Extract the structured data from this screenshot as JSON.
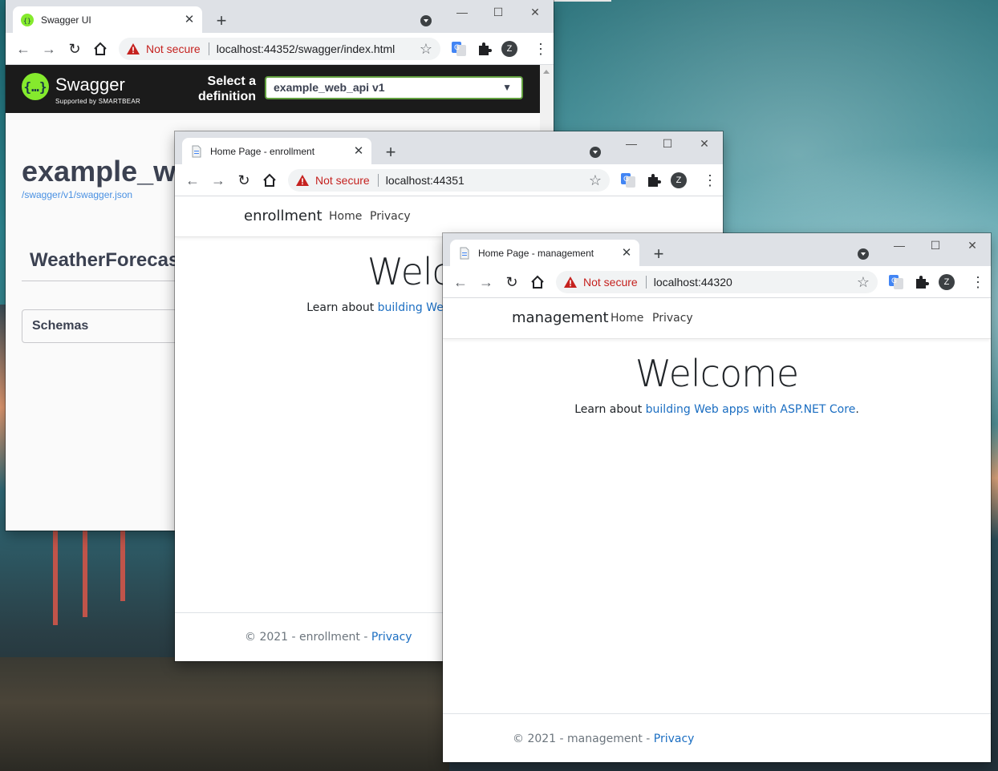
{
  "swagger_window": {
    "tab_title": "Swagger UI",
    "not_secure": "Not secure",
    "url": "localhost:44352/swagger/index.html",
    "avatar_letter": "Z",
    "brand": "Swagger",
    "brand_sub": "Supported by SMARTBEAR",
    "select_label": "Select a definition",
    "select_value": "example_web_api v1",
    "api_title": "example_web_api",
    "spec_link": "/swagger/v1/swagger.json",
    "tag": "WeatherForecast",
    "schemas": "Schemas"
  },
  "enrollment_window": {
    "tab_title": "Home Page - enrollment",
    "not_secure": "Not secure",
    "url": "localhost:44351",
    "avatar_letter": "Z",
    "brand": "enrollment",
    "nav_home": "Home",
    "nav_privacy": "Privacy",
    "welcome": "Welcome",
    "learn_prefix": "Learn about ",
    "learn_link": "building Web apps with ASP.NET Core",
    "learn_suffix": ".",
    "footer_text": "© 2021 - enrollment - ",
    "footer_link": "Privacy"
  },
  "management_window": {
    "tab_title": "Home Page - management",
    "not_secure": "Not secure",
    "url": "localhost:44320",
    "avatar_letter": "Z",
    "brand": "management",
    "nav_home": "Home",
    "nav_privacy": "Privacy",
    "welcome": "Welcome",
    "learn_prefix": "Learn about ",
    "learn_link": "building Web apps with ASP.NET Core",
    "learn_suffix": ".",
    "footer_text": "© 2021 - management - ",
    "footer_link": "Privacy"
  },
  "icons": {
    "back": "arrow-left-icon",
    "forward": "arrow-right-icon",
    "reload": "reload-icon",
    "home": "home-icon",
    "warning": "warning-triangle-icon",
    "star": "bookmark-star-icon",
    "translate": "google-translate-icon",
    "extensions": "puzzle-icon",
    "menu": "kebab-menu-icon"
  },
  "colors": {
    "swagger_green": "#85ea2d",
    "swagger_header": "#1b1b1b",
    "not_secure_red": "#c5221f",
    "link_blue": "#1b6ec2",
    "tabstrip": "#dee1e6"
  }
}
